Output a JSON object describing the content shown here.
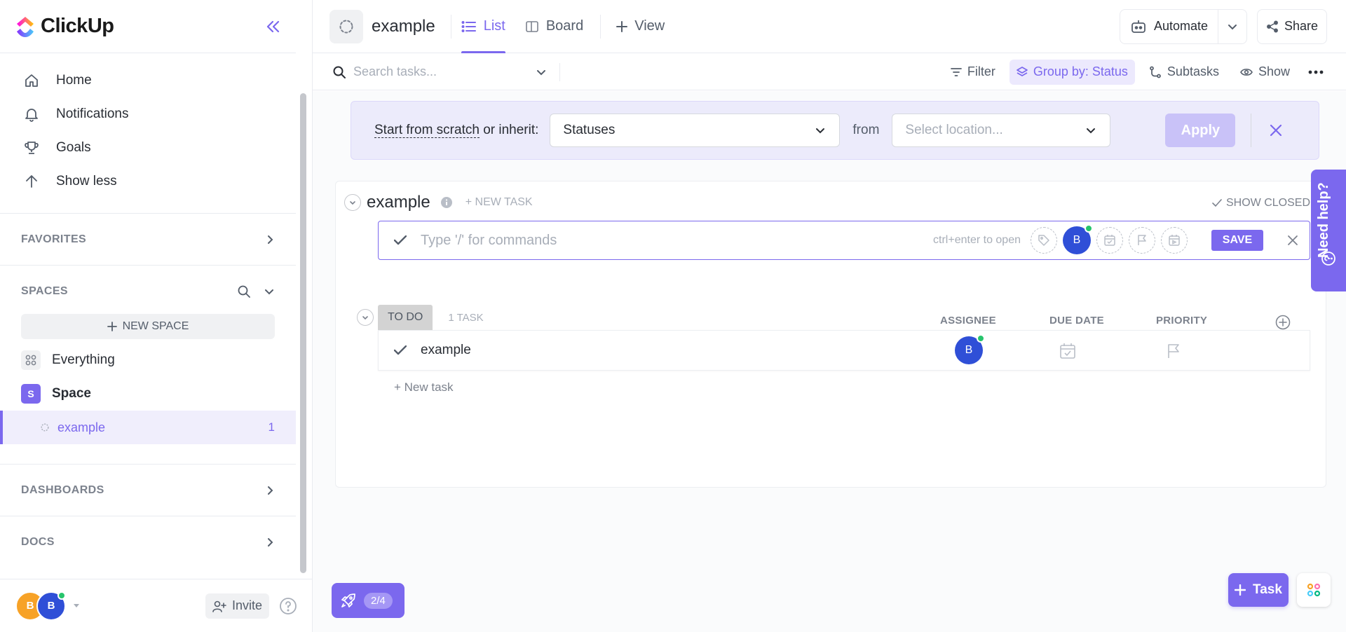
{
  "app": {
    "name": "ClickUp",
    "brand_color": "#7b68ee"
  },
  "sidebar": {
    "nav": [
      {
        "label": "Home",
        "icon": "home-icon"
      },
      {
        "label": "Notifications",
        "icon": "bell-icon"
      },
      {
        "label": "Goals",
        "icon": "trophy-icon"
      },
      {
        "label": "Show less",
        "icon": "arrow-up-icon"
      }
    ],
    "favorites_label": "FAVORITES",
    "spaces_label": "SPACES",
    "new_space_label": "NEW SPACE",
    "everything_label": "Everything",
    "space": {
      "initial": "S",
      "name": "Space",
      "color": "#7b68ee"
    },
    "active_list": {
      "name": "example",
      "count": "1"
    },
    "dashboards_label": "DASHBOARDS",
    "docs_label": "DOCS",
    "footer": {
      "avatars": [
        {
          "initial": "B",
          "color": "#f7a227"
        },
        {
          "initial": "B",
          "color": "#2f4fd7"
        }
      ],
      "invite_label": "Invite"
    }
  },
  "topbar": {
    "title": "example",
    "tabs": [
      {
        "label": "List",
        "active": true
      },
      {
        "label": "Board",
        "active": false
      }
    ],
    "add_view_label": "View",
    "automate_label": "Automate",
    "share_label": "Share"
  },
  "toolbar": {
    "search_placeholder": "Search tasks...",
    "filter_label": "Filter",
    "group_label": "Group by: Status",
    "subtasks_label": "Subtasks",
    "show_label": "Show"
  },
  "banner": {
    "link_text": "Start from scratch",
    "text_after": " or inherit:",
    "select_value": "Statuses",
    "from_label": "from",
    "location_placeholder": "Select location...",
    "apply_label": "Apply"
  },
  "list": {
    "title": "example",
    "new_task_label": "+ NEW TASK",
    "show_closed_label": "SHOW CLOSED",
    "input_placeholder": "Type '/' for commands",
    "input_hint": "ctrl+enter to open",
    "input_assignee": "B",
    "save_label": "SAVE",
    "status": {
      "label": "TO DO",
      "count_label": "1 TASK"
    },
    "columns": {
      "assignee": "ASSIGNEE",
      "due_date": "DUE DATE",
      "priority": "PRIORITY"
    },
    "tasks": [
      {
        "name": "example",
        "assignee": "B"
      }
    ],
    "add_task_label": "+ New task"
  },
  "floating": {
    "need_help_label": "Need help?",
    "progress_label": "2/4",
    "task_button_label": "Task"
  }
}
